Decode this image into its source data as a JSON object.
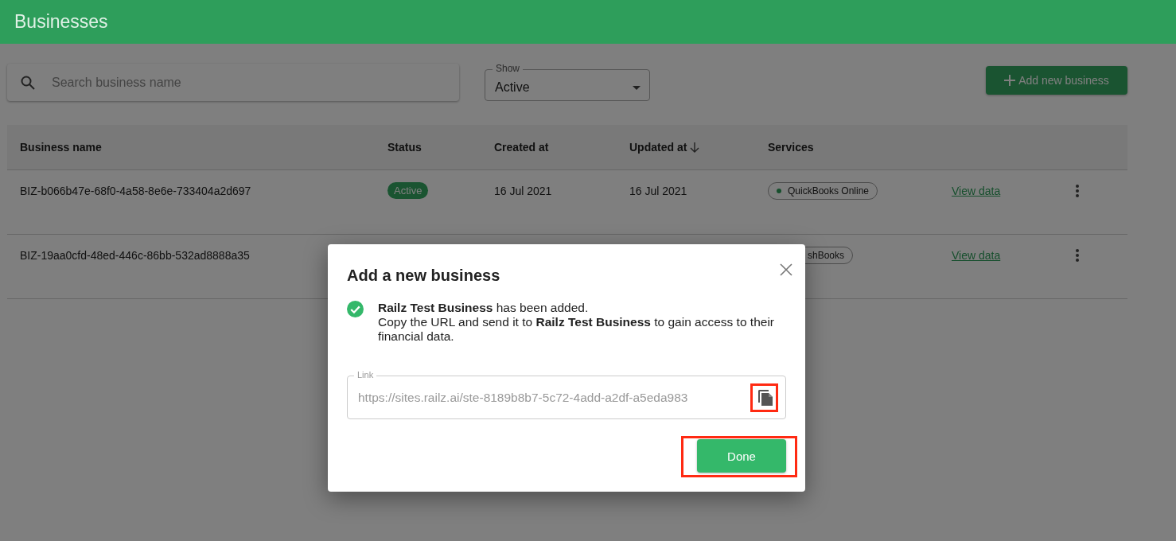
{
  "header": {
    "title": "Businesses"
  },
  "search": {
    "placeholder": "Search business name"
  },
  "show_select": {
    "label": "Show",
    "value": "Active"
  },
  "add_button": {
    "label": "Add new business"
  },
  "table": {
    "columns": [
      {
        "label": "Business name",
        "sorted": false
      },
      {
        "label": "Status",
        "sorted": false
      },
      {
        "label": "Created at",
        "sorted": false
      },
      {
        "label": "Updated at",
        "sorted": true
      },
      {
        "label": "Services",
        "sorted": false
      }
    ],
    "rows": [
      {
        "name": "BIZ-b066b47e-68f0-4a58-8e6e-733404a2d697",
        "status": "Active",
        "created": "16 Jul 2021",
        "updated": "16 Jul 2021",
        "services": [
          {
            "label": "QuickBooks Online",
            "kind": "full"
          }
        ],
        "action": "View data"
      },
      {
        "name": "BIZ-19aa0cfd-48ed-446c-86bb-532ad8888a35",
        "services": [
          {
            "label": "shBooks",
            "kind": "cut"
          }
        ],
        "action": "View data"
      }
    ]
  },
  "dialog": {
    "title": "Add a new business",
    "message_lines": [
      "**Railz Test Business** has been added.",
      "Copy the URL and send it to **Railz Test Business** to gain access to their financial data."
    ],
    "link": {
      "label": "Link",
      "value": "https://sites.railz.ai/ste-8189b8b7-5c72-4add-a2df-a5eda983"
    },
    "copy_button": {
      "highlighted": true
    },
    "done_button": {
      "label": "Done",
      "highlighted": true
    }
  }
}
